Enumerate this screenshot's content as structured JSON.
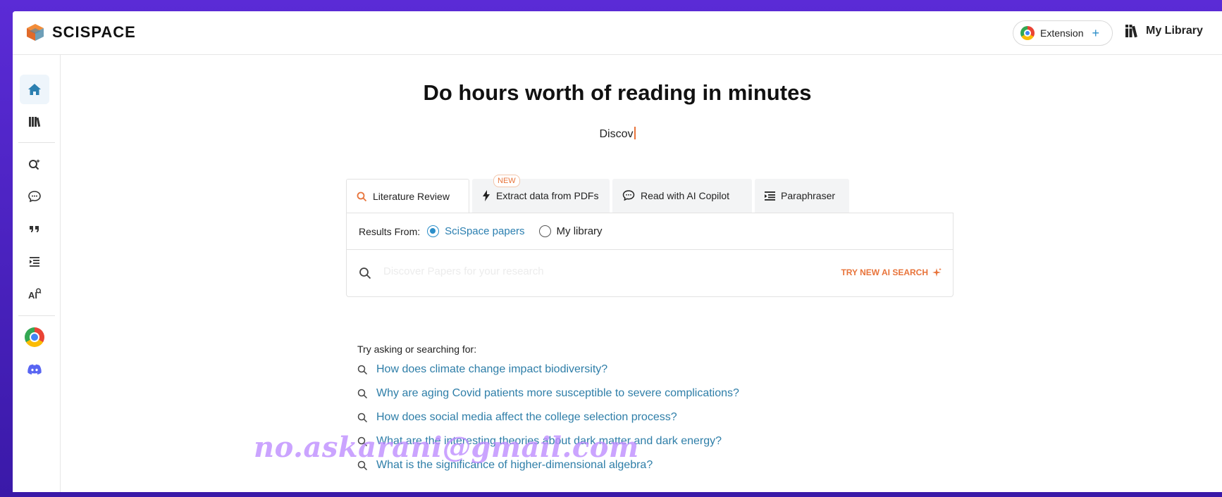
{
  "app": {
    "brand": "SCISPACE"
  },
  "header": {
    "extension_label": "Extension",
    "extension_plus": "+",
    "library_label": "My Library"
  },
  "sidebar": {
    "items": [
      {
        "name": "home",
        "icon": "home-icon",
        "active": true
      },
      {
        "name": "library",
        "icon": "library-icon"
      },
      {
        "name": "literature-search",
        "icon": "search-sparkle-icon"
      },
      {
        "name": "copilot",
        "icon": "chat-icon"
      },
      {
        "name": "citation",
        "icon": "quote-icon"
      },
      {
        "name": "paraphraser",
        "icon": "paraphrase-icon"
      },
      {
        "name": "ai-detector",
        "icon": "ai-detect-icon"
      },
      {
        "name": "chrome-extension",
        "icon": "chrome-icon"
      },
      {
        "name": "discord",
        "icon": "discord-icon"
      }
    ]
  },
  "main": {
    "title": "Do hours worth of reading in minutes",
    "subtitle": "Discov",
    "tabs": [
      {
        "label": "Literature Review",
        "icon": "search-icon",
        "active": true
      },
      {
        "label": "Extract data from PDFs",
        "icon": "lightning-icon",
        "badge": "NEW"
      },
      {
        "label": "Read with AI Copilot",
        "icon": "chat-icon"
      },
      {
        "label": "Paraphraser",
        "icon": "paraphrase-icon"
      }
    ],
    "results_from_label": "Results From:",
    "results_options": [
      {
        "label": "SciSpace papers",
        "selected": true
      },
      {
        "label": "My library",
        "selected": false
      }
    ],
    "search": {
      "placeholder": "Discover Papers for your research",
      "value": ""
    },
    "try_ai_label": "TRY NEW AI SEARCH",
    "suggestions_heading": "Try asking or searching for:",
    "suggestions": [
      "How does climate change impact biodiversity?",
      "Why are aging Covid patients more susceptible to severe complications?",
      "How does social media affect the college selection process?",
      "What are the interesting theories about dark matter and dark energy?",
      "What is the significance of higher-dimensional algebra?"
    ]
  },
  "watermark": "no.askarani@gmail.com",
  "colors": {
    "accent_blue": "#2b7fb0",
    "accent_orange": "#e8743b",
    "frame_purple": "#4b1fb0"
  }
}
